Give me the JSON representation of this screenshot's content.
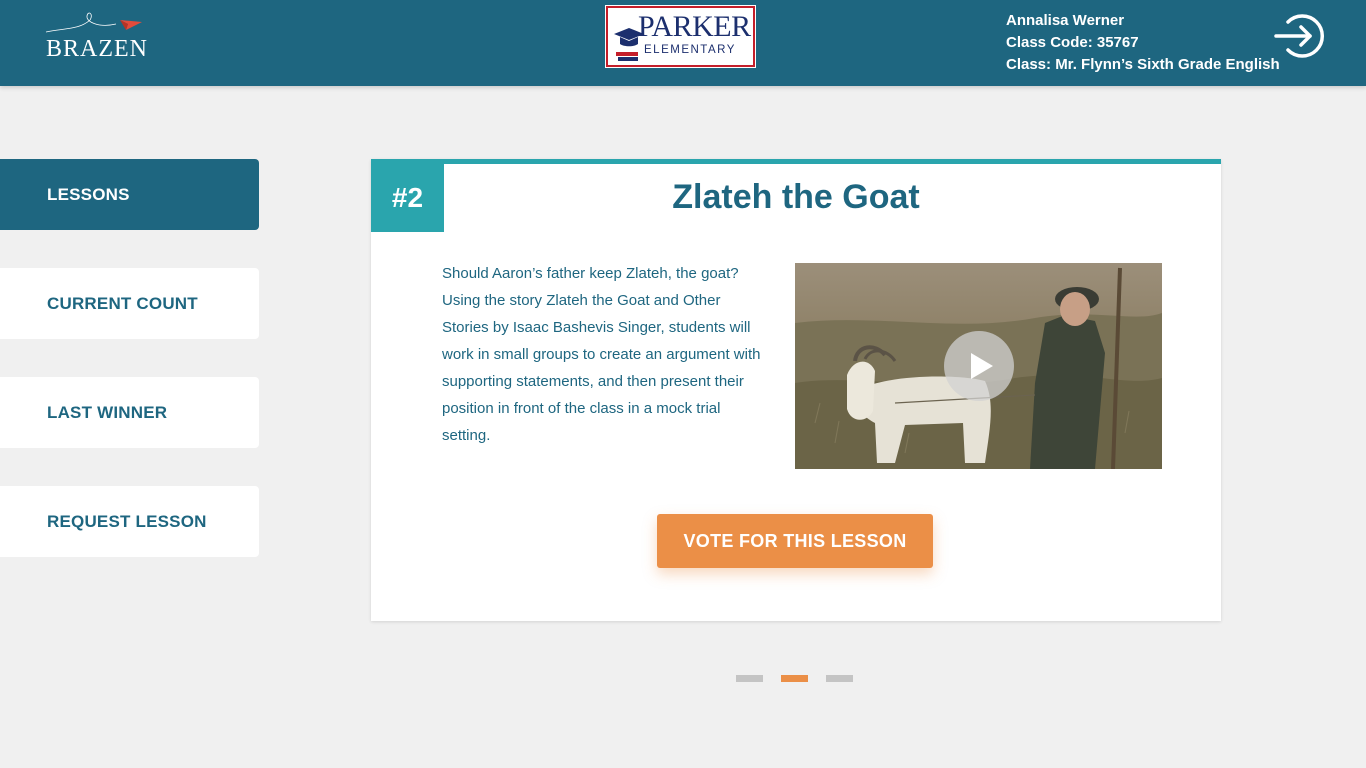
{
  "header": {
    "brand_name": "BRAZEN",
    "school": {
      "name": "PARKER",
      "subtitle": "ELEMENTARY"
    },
    "user": {
      "name": "Annalisa Werner",
      "class_code": "Class Code: 35767",
      "class_name": "Class: Mr. Flynn’s Sixth Grade English"
    },
    "logout_icon": "logout-icon"
  },
  "sidebar": {
    "items": [
      {
        "label": "LESSONS",
        "active": true
      },
      {
        "label": "CURRENT COUNT",
        "active": false
      },
      {
        "label": "LAST WINNER",
        "active": false
      },
      {
        "label": "REQUEST LESSON",
        "active": false
      }
    ]
  },
  "lesson": {
    "number": "#2",
    "title": "Zlateh the Goat",
    "description": "Should Aaron’s father keep Zlateh, the goat? Using the story Zlateh the Goat and Other Stories by Isaac Bashevis Singer, students will work in small groups to create an argument with supporting statements, and then present their position in front of the class in a mock trial setting.",
    "video_icon": "play-icon",
    "vote_label": "VOTE FOR THIS LESSON"
  },
  "pager": {
    "total": 3,
    "current": 2
  },
  "colors": {
    "primary": "#1e6680",
    "teal": "#2aa5ad",
    "accent": "#eb8f47",
    "background": "#f0f0f0"
  }
}
